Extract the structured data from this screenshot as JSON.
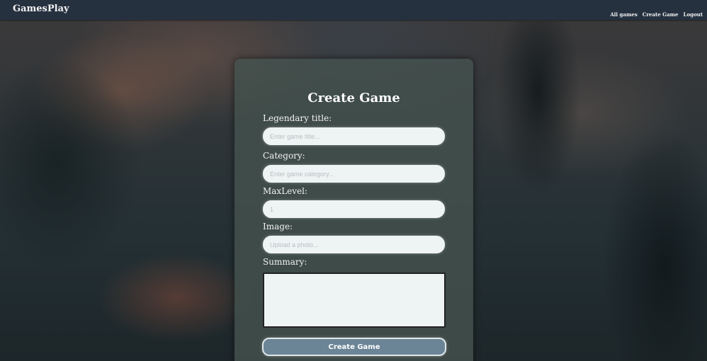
{
  "navbar": {
    "brand": "GamesPlay",
    "links": [
      {
        "label": "All games"
      },
      {
        "label": "Create Game"
      },
      {
        "label": "Logout"
      }
    ]
  },
  "form": {
    "title": "Create Game",
    "fields": {
      "title": {
        "label": "Legendary title:",
        "placeholder": "Enter game title...",
        "value": ""
      },
      "category": {
        "label": "Category:",
        "placeholder": "Enter game category...",
        "value": ""
      },
      "max_level": {
        "label": "MaxLevel:",
        "placeholder": "1",
        "value": ""
      },
      "image": {
        "label": "Image:",
        "placeholder": "Upload a photo...",
        "value": ""
      },
      "summary": {
        "label": "Summary:",
        "value": ""
      }
    },
    "submit_label": "Create Game"
  }
}
